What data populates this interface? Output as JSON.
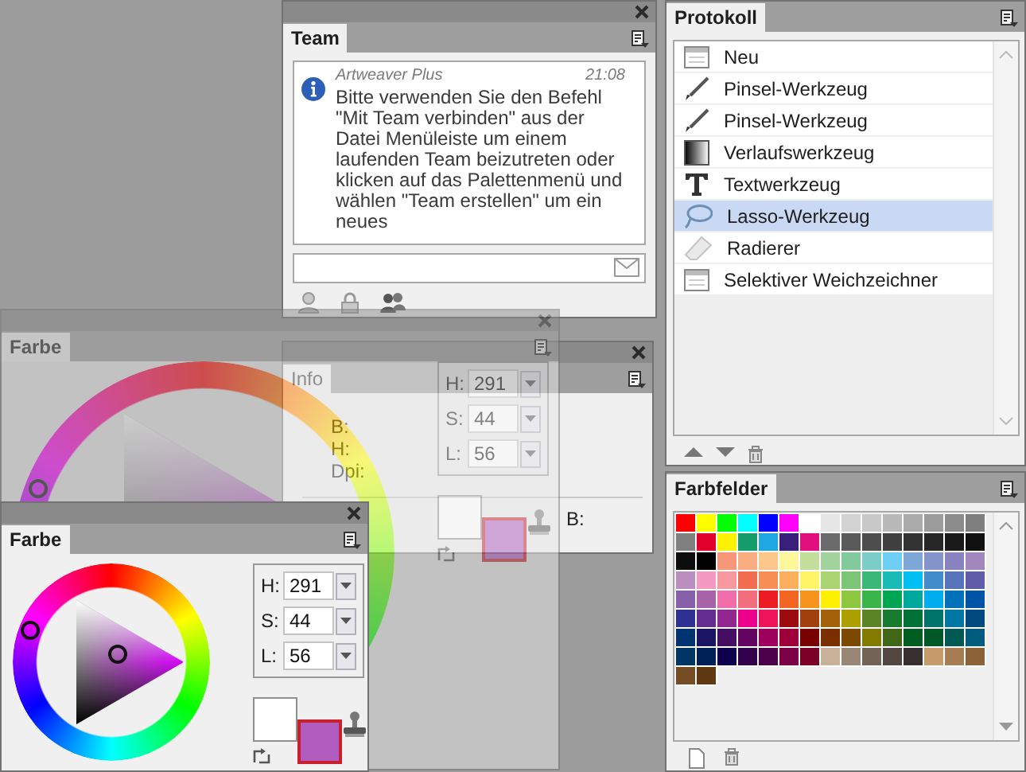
{
  "team_panel": {
    "tab": "Team",
    "message": {
      "sender": "Artweaver Plus",
      "time": "21:08",
      "text": "Bitte verwenden Sie den Befehl \"Mit Team verbinden\" aus der Datei Menüleiste um einem laufenden Team beizutreten oder klicken auf das Palettenmenü und wählen \"Team erstellen\" um ein neues"
    }
  },
  "info_panel": {
    "tab": "Info",
    "labels": [
      "B:",
      "H:",
      "Dpi:"
    ],
    "right_label": "B:"
  },
  "color_panels": [
    {
      "tab": "Farbe",
      "dragging": true,
      "fields": [
        {
          "label": "H:",
          "value": "291"
        },
        {
          "label": "S:",
          "value": "44"
        },
        {
          "label": "L:",
          "value": "56"
        }
      ]
    },
    {
      "tab": "Farbe",
      "dragging": false,
      "fields": [
        {
          "label": "H:",
          "value": "291"
        },
        {
          "label": "S:",
          "value": "44"
        },
        {
          "label": "L:",
          "value": "56"
        }
      ]
    }
  ],
  "history_panel": {
    "tab": "Protokoll",
    "items": [
      {
        "label": "Neu",
        "kind": "document",
        "selected": false
      },
      {
        "label": "Pinsel-Werkzeug",
        "kind": "brush",
        "selected": false
      },
      {
        "label": "Pinsel-Werkzeug",
        "kind": "brush",
        "selected": false
      },
      {
        "label": "Verlaufswerkzeug",
        "kind": "gradient",
        "selected": false
      },
      {
        "label": "Textwerkzeug",
        "kind": "text",
        "selected": false
      },
      {
        "label": "Lasso-Werkzeug",
        "kind": "lasso",
        "selected": true
      },
      {
        "label": "Radierer",
        "kind": "eraser",
        "selected": false
      },
      {
        "label": "Selektiver Weichzeichner",
        "kind": "document",
        "selected": false
      }
    ]
  },
  "swatches_panel": {
    "tab": "Farbfelder",
    "swatches": [
      {
        "color": "#ff0000"
      },
      {
        "color": "#ffff00"
      },
      {
        "color": "#00ff00"
      },
      {
        "color": "#00ffff"
      },
      {
        "color": "#0000ff"
      },
      {
        "color": "#ff00ff"
      },
      {
        "color": "#ffffff"
      },
      {
        "color": "#e6e6e6"
      },
      {
        "color": "#d2d2d2"
      },
      {
        "color": "#c8c8c8"
      },
      {
        "color": "#b9b9b9"
      },
      {
        "color": "#aaaaaa"
      },
      {
        "color": "#9b9b9b"
      },
      {
        "color": "#8c8c8c"
      },
      {
        "color": "#7f7f7f"
      },
      {
        "color": "#808080"
      },
      {
        "color": "#e0002a"
      },
      {
        "color": "#fff200"
      },
      {
        "color": "#169b6b"
      },
      {
        "color": "#1ea7e1"
      },
      {
        "color": "#3a1f7a"
      },
      {
        "color": "#e0117f"
      },
      {
        "color": "#6b6b6b"
      },
      {
        "color": "#5a5a5a"
      },
      {
        "color": "#4d4d4d"
      },
      {
        "color": "#404040"
      },
      {
        "color": "#333333"
      },
      {
        "color": "#262626"
      },
      {
        "color": "#1a1a1a"
      },
      {
        "color": "#111111"
      },
      {
        "color": "#0d0d0d"
      },
      {
        "color": "#000000"
      },
      {
        "color": "#f7977a"
      },
      {
        "color": "#f9ad81"
      },
      {
        "color": "#fdc68a"
      },
      {
        "color": "#fff79a"
      },
      {
        "color": "#c4df9b"
      },
      {
        "color": "#a3d39c"
      },
      {
        "color": "#82ca9d"
      },
      {
        "color": "#7bcdc8"
      },
      {
        "color": "#6ecff6"
      },
      {
        "color": "#7ea7d8"
      },
      {
        "color": "#8493ca"
      },
      {
        "color": "#8882be"
      },
      {
        "color": "#a187be"
      },
      {
        "color": "#bc8dbf"
      },
      {
        "color": "#f49ac2"
      },
      {
        "color": "#f6989d"
      },
      {
        "color": "#f26c4f"
      },
      {
        "color": "#f68e55"
      },
      {
        "color": "#fbaf5c"
      },
      {
        "color": "#fff467"
      },
      {
        "color": "#acd372"
      },
      {
        "color": "#7cc576"
      },
      {
        "color": "#3bb878"
      },
      {
        "color": "#1abbb4"
      },
      {
        "color": "#00bff3"
      },
      {
        "color": "#438ccb"
      },
      {
        "color": "#5574b9"
      },
      {
        "color": "#605ca8"
      },
      {
        "color": "#855fa8"
      },
      {
        "color": "#a763a8"
      },
      {
        "color": "#f06ea9"
      },
      {
        "color": "#f26d7d"
      },
      {
        "color": "#ed1c24"
      },
      {
        "color": "#f26522"
      },
      {
        "color": "#f7941d"
      },
      {
        "color": "#fff100"
      },
      {
        "color": "#8dc63f"
      },
      {
        "color": "#39b54a"
      },
      {
        "color": "#00a651"
      },
      {
        "color": "#00a99d"
      },
      {
        "color": "#00aeef"
      },
      {
        "color": "#0072bc"
      },
      {
        "color": "#0054a6"
      },
      {
        "color": "#2e3192"
      },
      {
        "color": "#662d91"
      },
      {
        "color": "#92278f"
      },
      {
        "color": "#ec008c"
      },
      {
        "color": "#ed145b"
      },
      {
        "color": "#9e0b0f"
      },
      {
        "color": "#a0410d"
      },
      {
        "color": "#a36209"
      },
      {
        "color": "#aba000"
      },
      {
        "color": "#598527"
      },
      {
        "color": "#197b30"
      },
      {
        "color": "#007236"
      },
      {
        "color": "#00746b"
      },
      {
        "color": "#0076a3"
      },
      {
        "color": "#004a80"
      },
      {
        "color": "#003471"
      },
      {
        "color": "#1b1464"
      },
      {
        "color": "#440e62"
      },
      {
        "color": "#630460"
      },
      {
        "color": "#9e005d"
      },
      {
        "color": "#9e0039"
      },
      {
        "color": "#790000"
      },
      {
        "color": "#7b2e00"
      },
      {
        "color": "#7d4900"
      },
      {
        "color": "#827b00"
      },
      {
        "color": "#406618"
      },
      {
        "color": "#005e20"
      },
      {
        "color": "#005826"
      },
      {
        "color": "#005952"
      },
      {
        "color": "#005b7f"
      },
      {
        "color": "#003663"
      },
      {
        "color": "#002157"
      },
      {
        "color": "#0d004c"
      },
      {
        "color": "#32004b"
      },
      {
        "color": "#4b0049"
      },
      {
        "color": "#7b0046"
      },
      {
        "color": "#7a0026"
      },
      {
        "color": "#c7b299"
      },
      {
        "color": "#998675"
      },
      {
        "color": "#736357"
      },
      {
        "color": "#534741"
      },
      {
        "color": "#362f2d"
      },
      {
        "color": "#c69c6d"
      },
      {
        "color": "#a67c52"
      },
      {
        "color": "#8c6239"
      },
      {
        "color": "#754c24"
      },
      {
        "color": "#603913"
      }
    ]
  }
}
